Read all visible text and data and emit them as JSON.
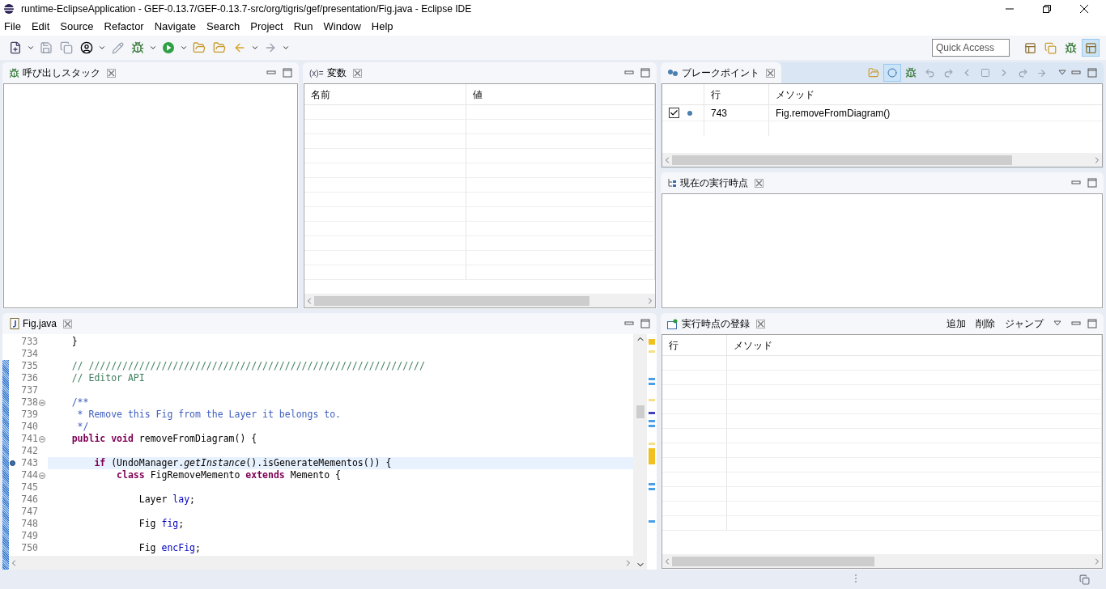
{
  "window": {
    "title": "runtime-EclipseApplication - GEF-0.13.7/GEF-0.13.7-src/org/tigris/gef/presentation/Fig.java - Eclipse IDE"
  },
  "menu": [
    "File",
    "Edit",
    "Source",
    "Refactor",
    "Navigate",
    "Search",
    "Project",
    "Run",
    "Window",
    "Help"
  ],
  "quick_access": {
    "placeholder": "Quick Access"
  },
  "call_stack": {
    "tab": {
      "title": "呼び出しスタック",
      "selected": true
    }
  },
  "variables": {
    "tab": {
      "icon_text": "(x)=",
      "title": "変数",
      "selected": true
    },
    "columns": [
      "名前",
      "値"
    ]
  },
  "breakpoints": {
    "tab": {
      "title": "ブレークポイント",
      "selected": true
    },
    "columns": [
      "行",
      "メソッド"
    ],
    "rows": [
      {
        "checked": true,
        "line": "743",
        "method": "Fig.removeFromDiagram()"
      }
    ]
  },
  "current_point": {
    "tab": {
      "title": "現在の実行時点",
      "selected": true
    }
  },
  "editor": {
    "tab": {
      "title": "Fig.java",
      "selected": true
    },
    "lines": [
      {
        "no": "733",
        "tokens": [
          {
            "kind": "plain",
            "t": "    }"
          }
        ]
      },
      {
        "no": "734"
      },
      {
        "no": "735",
        "tokens": [
          {
            "kind": "comment",
            "t": "    // ////////////////////////////////////////////////////////////"
          }
        ]
      },
      {
        "no": "736",
        "tokens": [
          {
            "kind": "comment",
            "t": "    // Editor API"
          }
        ]
      },
      {
        "no": "737"
      },
      {
        "no": "738",
        "fold": true,
        "tokens": [
          {
            "kind": "javadoc",
            "t": "    /**"
          }
        ]
      },
      {
        "no": "739",
        "tokens": [
          {
            "kind": "javadoc",
            "t": "     * Remove this Fig from the Layer it belongs to."
          }
        ]
      },
      {
        "no": "740",
        "tokens": [
          {
            "kind": "javadoc",
            "t": "     */"
          }
        ]
      },
      {
        "no": "741",
        "fold": true,
        "tokens": [
          {
            "kind": "keyword",
            "t": "    public void "
          },
          {
            "kind": "plain",
            "t": "removeFromDiagram() {"
          }
        ]
      },
      {
        "no": "742"
      },
      {
        "no": "743",
        "breakpoint": true,
        "current": true,
        "tokens": [
          {
            "kind": "keyword",
            "t": "        if "
          },
          {
            "kind": "plain",
            "t": "(UndoManager."
          },
          {
            "kind": "italic",
            "t": "getInstance"
          },
          {
            "kind": "plain",
            "t": "().isGenerateMementos()) {"
          }
        ]
      },
      {
        "no": "744",
        "fold": true,
        "tokens": [
          {
            "kind": "keyword",
            "t": "            class "
          },
          {
            "kind": "plain",
            "t": "FigRemoveMemento "
          },
          {
            "kind": "keyword",
            "t": "extends "
          },
          {
            "kind": "plain",
            "t": "Memento {"
          }
        ]
      },
      {
        "no": "745"
      },
      {
        "no": "746",
        "tokens": [
          {
            "kind": "plain",
            "t": "                Layer "
          },
          {
            "kind": "field",
            "t": "lay"
          },
          {
            "kind": "plain",
            "t": ";"
          }
        ]
      },
      {
        "no": "747"
      },
      {
        "no": "748",
        "tokens": [
          {
            "kind": "plain",
            "t": "                Fig "
          },
          {
            "kind": "field",
            "t": "fig"
          },
          {
            "kind": "plain",
            "t": ";"
          }
        ]
      },
      {
        "no": "749"
      },
      {
        "no": "750",
        "tokens": [
          {
            "kind": "plain",
            "t": "                Fig "
          },
          {
            "kind": "field",
            "t": "encFig"
          },
          {
            "kind": "plain",
            "t": ";"
          }
        ]
      }
    ]
  },
  "watchpoints": {
    "tab": {
      "title": "実行時点の登録",
      "selected": true
    },
    "actions": [
      "追加",
      "削除",
      "ジャンプ"
    ],
    "columns": [
      "行",
      "メソッド"
    ]
  }
}
